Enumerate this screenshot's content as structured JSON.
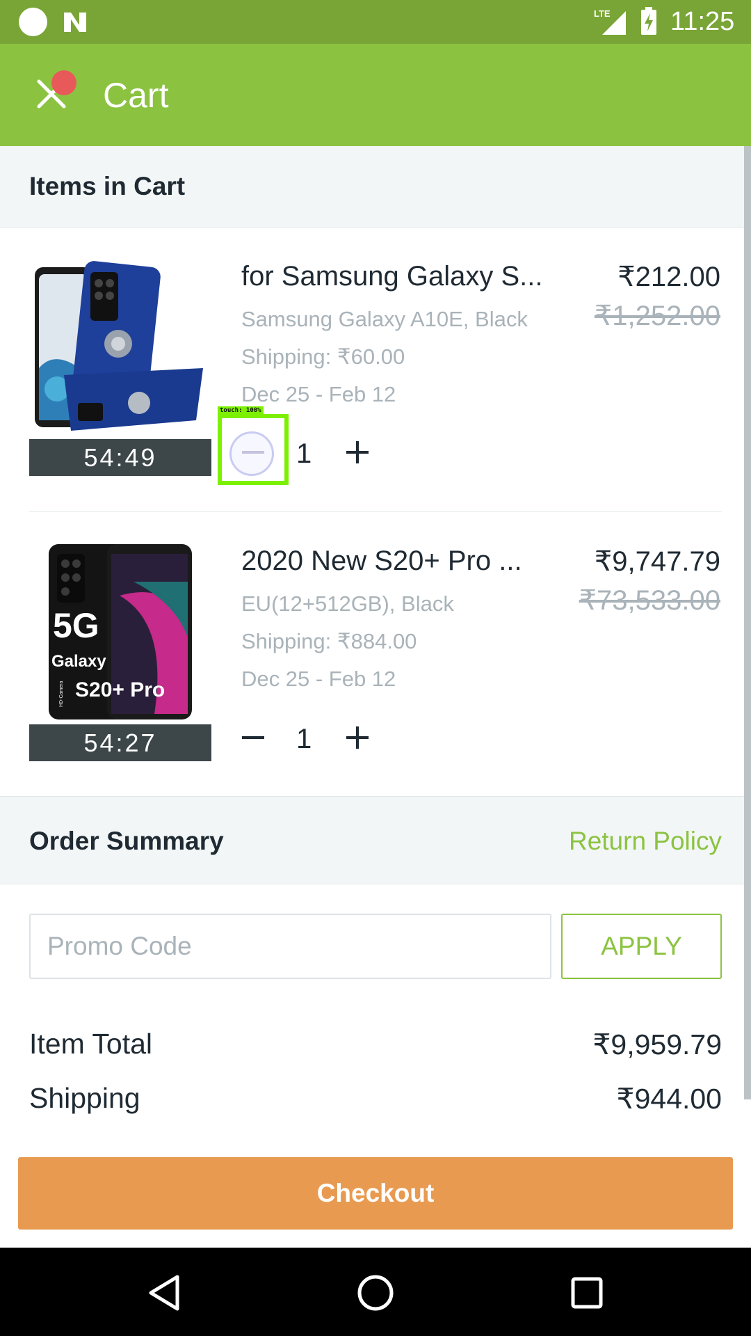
{
  "status_bar": {
    "time": "11:25",
    "network": "LTE"
  },
  "app_bar": {
    "title": "Cart",
    "close_icon": "close-icon"
  },
  "items_section": {
    "header": "Items in Cart"
  },
  "cart_items": [
    {
      "name": "for Samsung Galaxy S...",
      "variant": "Samsung Galaxy A10E, Black",
      "shipping": "Shipping: ₹60.00",
      "dates": "Dec 25 - Feb 12",
      "price": "₹212.00",
      "original_price": "₹1,252.00",
      "quantity": "1",
      "timer": "54:49"
    },
    {
      "name": "2020 New S20+ Pro ...",
      "variant": "EU(12+512GB), Black",
      "shipping": "Shipping: ₹884.00",
      "dates": "Dec 25 - Feb 12",
      "price": "₹9,747.79",
      "original_price": "₹73,533.00",
      "quantity": "1",
      "timer": "54:27",
      "image_text": {
        "line1": "5G",
        "line2": "Galaxy",
        "line3": "S20+ Pro",
        "side": "HD-Camera"
      }
    }
  ],
  "touch_overlay": {
    "label": "touch: 100%"
  },
  "order_summary": {
    "header": "Order Summary",
    "return_policy": "Return Policy",
    "promo_placeholder": "Promo Code",
    "apply_label": "APPLY",
    "item_total_label": "Item Total",
    "item_total_value": "₹9,959.79",
    "shipping_label": "Shipping",
    "shipping_value": "₹944.00"
  },
  "checkout": {
    "label": "Checkout"
  },
  "colors": {
    "status_bar": "#79a536",
    "app_bar": "#8bc341",
    "checkout": "#e89b50",
    "accent": "#8bc341"
  }
}
